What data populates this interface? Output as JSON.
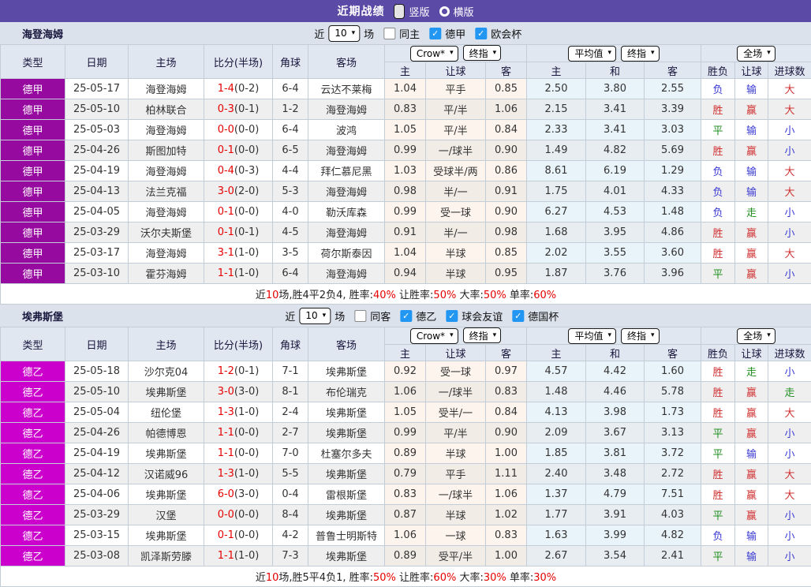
{
  "topbar": {
    "title": "近期战绩",
    "vertical_label": "竖版",
    "horizontal_label": "横版",
    "selected_layout": "竖版"
  },
  "colors": {
    "topbar_bg": "#5b4aa6",
    "page_bg": "#dbe2ec",
    "header_bg": "#e0e7f0",
    "row_stripe": "#efefef",
    "border": "#c3cdd8",
    "odds_tint": "#fdf5ed",
    "avg_tint": "#e9f3fa",
    "current_team_green": "#1f8f1f",
    "score_red": "#e60000",
    "win_red": "#d03030",
    "draw_green": "#1f8f1f",
    "lose_blue": "#3a3ad4",
    "checkbox_blue": "#2196f3",
    "league_bundesliga": "#970aa0",
    "league_bundesliga2": "#cc00cc"
  },
  "result_colors": {
    "胜": "r",
    "赢": "r",
    "大": "r",
    "平": "g",
    "走": "g",
    "负": "b",
    "输": "b",
    "小": "b"
  },
  "sections": [
    {
      "team": "海登海姆",
      "league": "德甲",
      "league_color": "#970aa0",
      "filter": {
        "near_label": "近",
        "count": "10",
        "matches_label": "场",
        "checkboxes": [
          {
            "label": "同主",
            "checked": false
          },
          {
            "label": "德甲",
            "checked": true
          },
          {
            "label": "欧会杯",
            "checked": true
          }
        ]
      },
      "header": {
        "main_cols": [
          "类型",
          "日期",
          "主场",
          "比分(半场)",
          "角球",
          "客场"
        ],
        "odds_selects": [
          "Crow*",
          "终指"
        ],
        "avg_selects": [
          "平均值",
          "终指"
        ],
        "result_select": "全场",
        "odds_cols": [
          "主",
          "让球",
          "客"
        ],
        "avg_cols": [
          "主",
          "和",
          "客"
        ],
        "result_cols": [
          "胜负",
          "让球",
          "进球数"
        ]
      },
      "rows": [
        {
          "date": "25-05-17",
          "home": "海登海姆",
          "home_current": true,
          "score": "1-4",
          "half": "(0-2)",
          "corners": "6-4",
          "away": "云达不莱梅",
          "away_current": false,
          "odds": [
            "1.04",
            "平手",
            "0.85"
          ],
          "avg": [
            "2.50",
            "3.80",
            "2.55"
          ],
          "results": [
            "负",
            "输",
            "大"
          ]
        },
        {
          "date": "25-05-10",
          "home": "柏林联合",
          "home_current": false,
          "score": "0-3",
          "half": "(0-1)",
          "corners": "1-2",
          "away": "海登海姆",
          "away_current": true,
          "odds": [
            "0.83",
            "平/半",
            "1.06"
          ],
          "avg": [
            "2.15",
            "3.41",
            "3.39"
          ],
          "results": [
            "胜",
            "赢",
            "大"
          ]
        },
        {
          "date": "25-05-03",
          "home": "海登海姆",
          "home_current": true,
          "score": "0-0",
          "half": "(0-0)",
          "corners": "6-4",
          "away": "波鸿",
          "away_current": false,
          "odds": [
            "1.05",
            "平/半",
            "0.84"
          ],
          "avg": [
            "2.33",
            "3.41",
            "3.03"
          ],
          "results": [
            "平",
            "输",
            "小"
          ]
        },
        {
          "date": "25-04-26",
          "home": "斯图加特",
          "home_current": false,
          "score": "0-1",
          "half": "(0-0)",
          "corners": "6-5",
          "away": "海登海姆",
          "away_current": true,
          "odds": [
            "0.99",
            "一/球半",
            "0.90"
          ],
          "avg": [
            "1.49",
            "4.82",
            "5.69"
          ],
          "results": [
            "胜",
            "赢",
            "小"
          ]
        },
        {
          "date": "25-04-19",
          "home": "海登海姆",
          "home_current": true,
          "score": "0-4",
          "half": "(0-3)",
          "corners": "4-4",
          "away": "拜仁慕尼黑",
          "away_current": false,
          "odds": [
            "1.03",
            "受球半/两",
            "0.86"
          ],
          "avg": [
            "8.61",
            "6.19",
            "1.29"
          ],
          "results": [
            "负",
            "输",
            "大"
          ]
        },
        {
          "date": "25-04-13",
          "home": "法兰克福",
          "home_current": false,
          "score": "3-0",
          "half": "(2-0)",
          "corners": "5-3",
          "away": "海登海姆",
          "away_current": true,
          "odds": [
            "0.98",
            "半/一",
            "0.91"
          ],
          "avg": [
            "1.75",
            "4.01",
            "4.33"
          ],
          "results": [
            "负",
            "输",
            "大"
          ]
        },
        {
          "date": "25-04-05",
          "home": "海登海姆",
          "home_current": true,
          "score": "0-1",
          "half": "(0-0)",
          "corners": "4-0",
          "away": "勒沃库森",
          "away_current": false,
          "odds": [
            "0.99",
            "受一球",
            "0.90"
          ],
          "avg": [
            "6.27",
            "4.53",
            "1.48"
          ],
          "results": [
            "负",
            "走",
            "小"
          ]
        },
        {
          "date": "25-03-29",
          "home": "沃尔夫斯堡",
          "home_current": false,
          "score": "0-1",
          "half": "(0-1)",
          "corners": "4-5",
          "away": "海登海姆",
          "away_current": true,
          "odds": [
            "0.91",
            "半/一",
            "0.98"
          ],
          "avg": [
            "1.68",
            "3.95",
            "4.86"
          ],
          "results": [
            "胜",
            "赢",
            "小"
          ]
        },
        {
          "date": "25-03-17",
          "home": "海登海姆",
          "home_current": true,
          "score": "3-1",
          "half": "(1-0)",
          "corners": "3-5",
          "away": "荷尔斯泰因",
          "away_current": false,
          "odds": [
            "1.04",
            "半球",
            "0.85"
          ],
          "avg": [
            "2.02",
            "3.55",
            "3.60"
          ],
          "results": [
            "胜",
            "赢",
            "大"
          ]
        },
        {
          "date": "25-03-10",
          "home": "霍芬海姆",
          "home_current": false,
          "score": "1-1",
          "half": "(1-0)",
          "corners": "6-4",
          "away": "海登海姆",
          "away_current": true,
          "odds": [
            "0.94",
            "半球",
            "0.95"
          ],
          "avg": [
            "1.87",
            "3.76",
            "3.96"
          ],
          "results": [
            "平",
            "赢",
            "小"
          ]
        }
      ],
      "summary": [
        [
          "近",
          false
        ],
        [
          "10",
          true
        ],
        [
          "场,胜4平2负4, 胜率:",
          false
        ],
        [
          "40%",
          true
        ],
        [
          " 让胜率:",
          false
        ],
        [
          "50%",
          true
        ],
        [
          " 大率:",
          false
        ],
        [
          "50%",
          true
        ],
        [
          " 单率:",
          false
        ],
        [
          "60%",
          true
        ]
      ]
    },
    {
      "team": "埃弗斯堡",
      "league": "德乙",
      "league_color": "#cc00cc",
      "filter": {
        "near_label": "近",
        "count": "10",
        "matches_label": "场",
        "checkboxes": [
          {
            "label": "同客",
            "checked": false
          },
          {
            "label": "德乙",
            "checked": true
          },
          {
            "label": "球会友谊",
            "checked": true
          },
          {
            "label": "德国杯",
            "checked": true
          }
        ]
      },
      "header": {
        "main_cols": [
          "类型",
          "日期",
          "主场",
          "比分(半场)",
          "角球",
          "客场"
        ],
        "odds_selects": [
          "Crow*",
          "终指"
        ],
        "avg_selects": [
          "平均值",
          "终指"
        ],
        "result_select": "全场",
        "odds_cols": [
          "主",
          "让球",
          "客"
        ],
        "avg_cols": [
          "主",
          "和",
          "客"
        ],
        "result_cols": [
          "胜负",
          "让球",
          "进球数"
        ]
      },
      "rows": [
        {
          "date": "25-05-18",
          "home": "沙尔克04",
          "home_current": false,
          "score": "1-2",
          "half": "(0-1)",
          "corners": "7-1",
          "away": "埃弗斯堡",
          "away_current": true,
          "odds": [
            "0.92",
            "受一球",
            "0.97"
          ],
          "avg": [
            "4.57",
            "4.42",
            "1.60"
          ],
          "results": [
            "胜",
            "走",
            "小"
          ]
        },
        {
          "date": "25-05-10",
          "home": "埃弗斯堡",
          "home_current": true,
          "score": "3-0",
          "half": "(3-0)",
          "corners": "8-1",
          "away": "布伦瑞克",
          "away_current": false,
          "odds": [
            "1.06",
            "一/球半",
            "0.83"
          ],
          "avg": [
            "1.48",
            "4.46",
            "5.78"
          ],
          "results": [
            "胜",
            "赢",
            "走"
          ]
        },
        {
          "date": "25-05-04",
          "home": "纽伦堡",
          "home_current": false,
          "score": "1-3",
          "half": "(1-0)",
          "corners": "2-4",
          "away": "埃弗斯堡",
          "away_current": true,
          "odds": [
            "1.05",
            "受半/一",
            "0.84"
          ],
          "avg": [
            "4.13",
            "3.98",
            "1.73"
          ],
          "results": [
            "胜",
            "赢",
            "大"
          ]
        },
        {
          "date": "25-04-26",
          "home": "帕德博恩",
          "home_current": false,
          "score": "1-1",
          "half": "(0-0)",
          "corners": "2-7",
          "away": "埃弗斯堡",
          "away_current": true,
          "odds": [
            "0.99",
            "平/半",
            "0.90"
          ],
          "avg": [
            "2.09",
            "3.67",
            "3.13"
          ],
          "results": [
            "平",
            "赢",
            "小"
          ]
        },
        {
          "date": "25-04-19",
          "home": "埃弗斯堡",
          "home_current": true,
          "score": "1-1",
          "half": "(0-0)",
          "corners": "7-0",
          "away": "杜塞尔多夫",
          "away_current": false,
          "odds": [
            "0.89",
            "半球",
            "1.00"
          ],
          "avg": [
            "1.85",
            "3.81",
            "3.72"
          ],
          "results": [
            "平",
            "输",
            "小"
          ]
        },
        {
          "date": "25-04-12",
          "home": "汉诺威96",
          "home_current": false,
          "score": "1-3",
          "half": "(1-0)",
          "corners": "5-5",
          "away": "埃弗斯堡",
          "away_current": true,
          "odds": [
            "0.79",
            "平手",
            "1.11"
          ],
          "avg": [
            "2.40",
            "3.48",
            "2.72"
          ],
          "results": [
            "胜",
            "赢",
            "大"
          ]
        },
        {
          "date": "25-04-06",
          "home": "埃弗斯堡",
          "home_current": true,
          "score": "6-0",
          "half": "(3-0)",
          "corners": "0-4",
          "away": "雷根斯堡",
          "away_current": false,
          "odds": [
            "0.83",
            "一/球半",
            "1.06"
          ],
          "avg": [
            "1.37",
            "4.79",
            "7.51"
          ],
          "results": [
            "胜",
            "赢",
            "大"
          ]
        },
        {
          "date": "25-03-29",
          "home": "汉堡",
          "home_current": false,
          "score": "0-0",
          "half": "(0-0)",
          "corners": "8-4",
          "away": "埃弗斯堡",
          "away_current": true,
          "odds": [
            "0.87",
            "半球",
            "1.02"
          ],
          "avg": [
            "1.77",
            "3.91",
            "4.03"
          ],
          "results": [
            "平",
            "赢",
            "小"
          ]
        },
        {
          "date": "25-03-15",
          "home": "埃弗斯堡",
          "home_current": true,
          "score": "0-1",
          "half": "(0-0)",
          "corners": "4-2",
          "away": "普鲁士明斯特",
          "away_current": false,
          "odds": [
            "1.06",
            "一球",
            "0.83"
          ],
          "avg": [
            "1.63",
            "3.99",
            "4.82"
          ],
          "results": [
            "负",
            "输",
            "小"
          ]
        },
        {
          "date": "25-03-08",
          "home": "凯泽斯劳滕",
          "home_current": false,
          "score": "1-1",
          "half": "(1-0)",
          "corners": "7-3",
          "away": "埃弗斯堡",
          "away_current": true,
          "odds": [
            "0.89",
            "受平/半",
            "1.00"
          ],
          "avg": [
            "2.67",
            "3.54",
            "2.41"
          ],
          "results": [
            "平",
            "输",
            "小"
          ]
        }
      ],
      "summary": [
        [
          "近",
          false
        ],
        [
          "10",
          true
        ],
        [
          "场,胜5平4负1, 胜率:",
          false
        ],
        [
          "50%",
          true
        ],
        [
          " 让胜率:",
          false
        ],
        [
          "60%",
          true
        ],
        [
          " 大率:",
          false
        ],
        [
          "30%",
          true
        ],
        [
          " 单率:",
          false
        ],
        [
          "30%",
          true
        ]
      ]
    }
  ]
}
